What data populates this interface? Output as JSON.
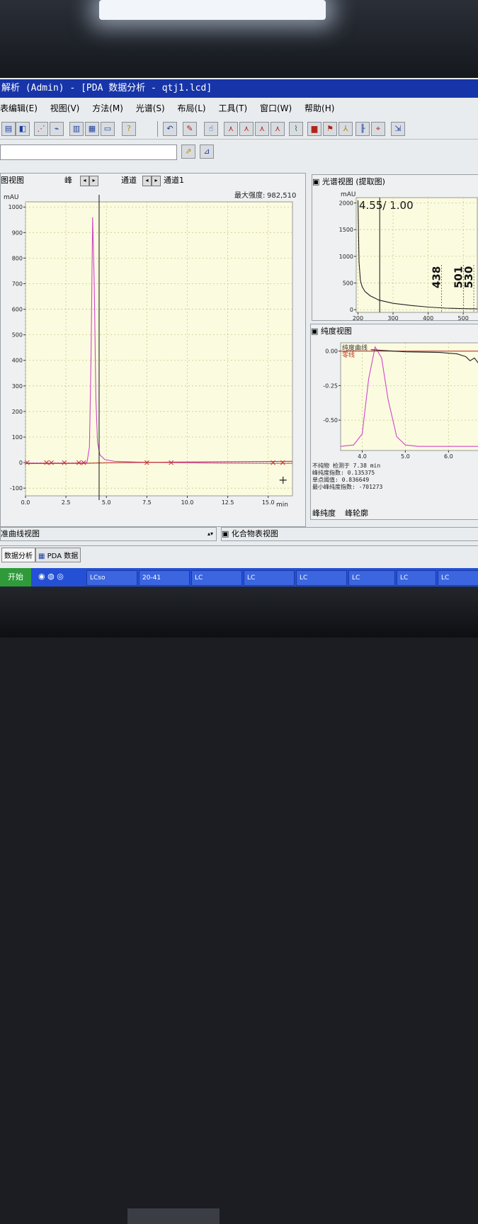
{
  "window": {
    "title": "解析 (Admin) - [PDA 数据分析 - qtj1.lcd]"
  },
  "menu": [
    "表编辑(E)",
    "视图(V)",
    "方法(M)",
    "光谱(S)",
    "布局(L)",
    "工具(T)",
    "窗口(W)",
    "帮助(H)"
  ],
  "chromatogram_panel": {
    "title": "图视图",
    "peak_label": "峰",
    "channel_label": "通道",
    "channel_value": "通道1",
    "max_intensity_label": "最大强度:",
    "max_intensity_value": "982,510",
    "unit_label": "mAU",
    "x_unit": "min"
  },
  "spectrum_panel": {
    "title": "光谱视图 (提取图)",
    "unit_label": "mAU",
    "time_label": "4.55/ 1.00",
    "peak_labels": [
      "438",
      "501",
      "530"
    ]
  },
  "purity_panel": {
    "title": "纯度视图",
    "legend_purity_curve": "纯度曲线",
    "legend_zero_line": "零线",
    "impurity_label": "不纯物 检测于",
    "impurity_value": "7.38 min",
    "peak_purity_label": "峰纯度指数:",
    "peak_purity_value": "0.135375",
    "single_point_label": "单点阈值:",
    "single_point_value": "0.836649",
    "min_peak_purity_label": "最小峰纯度指数:",
    "min_peak_purity_value": "-701273",
    "tab_purity": "峰纯度",
    "tab_outline": "峰轮廓"
  },
  "status": {
    "calibration_view": "准曲线视图",
    "compound_table_view": "化合物表视图",
    "tab_data_analysis": "数据分析",
    "tab_pda_data": "PDA 数据"
  },
  "taskbar": {
    "start": "开始",
    "items": [
      "LCso",
      "20-41",
      "LC",
      "LC",
      "LC",
      "LC",
      "LC",
      "LC"
    ]
  },
  "chart_data": [
    {
      "type": "line",
      "title": "",
      "xlabel": "min",
      "ylabel": "mAU",
      "xlim": [
        0,
        16.5
      ],
      "ylim": [
        -130,
        1020
      ],
      "xticks": [
        "0.0",
        "2.5",
        "5.0",
        "7.5",
        "10.0",
        "12.5",
        "15.0"
      ],
      "yticks": [
        "-100",
        "0",
        "100",
        "200",
        "300",
        "400",
        "500",
        "600",
        "700",
        "800",
        "900",
        "1000"
      ],
      "series": [
        {
          "color": "#d146c8",
          "x": [
            0.0,
            3.0,
            3.8,
            3.95,
            4.05,
            4.15,
            4.25,
            4.35,
            4.45,
            4.6,
            4.9,
            5.5,
            7.0,
            9.0,
            12.0,
            16.5
          ],
          "y": [
            -2,
            -2,
            0,
            60,
            400,
            960,
            700,
            250,
            80,
            30,
            12,
            5,
            2,
            0,
            -2,
            -3
          ]
        },
        {
          "color": "#c0392b",
          "x": [
            0.0,
            3.5,
            4.2,
            5.0,
            9.0,
            16.5
          ],
          "y": [
            -4,
            -3,
            -2,
            -1,
            2,
            5
          ]
        }
      ],
      "markers": [
        {
          "time": 0.1,
          "label": "peak-marker"
        },
        {
          "time": 1.3,
          "label": "peak-marker"
        },
        {
          "time": 1.6,
          "label": "peak-marker"
        },
        {
          "time": 2.4,
          "label": "peak-marker"
        },
        {
          "time": 3.3,
          "label": "peak-marker"
        },
        {
          "time": 3.6,
          "label": "peak-marker"
        },
        {
          "time": 7.5,
          "label": "peak-marker"
        },
        {
          "time": 9.0,
          "label": "peak-marker"
        },
        {
          "time": 15.3,
          "label": "peak-marker"
        },
        {
          "time": 15.9,
          "label": "peak-marker"
        }
      ],
      "cursor_time": 4.55,
      "grid": true
    },
    {
      "type": "line",
      "xlabel": "",
      "ylabel": "mAU",
      "xlim": [
        195,
        540
      ],
      "ylim": [
        -50,
        2100
      ],
      "xticks": [
        "200",
        "300",
        "400",
        "500"
      ],
      "yticks": [
        "0",
        "500",
        "1000",
        "1500",
        "2000"
      ],
      "series": [
        {
          "color": "#222222",
          "x": [
            200,
            203,
            207,
            212,
            220,
            235,
            260,
            300,
            350,
            400,
            450,
            500,
            540
          ],
          "y": [
            2050,
            900,
            550,
            430,
            340,
            260,
            180,
            120,
            80,
            50,
            30,
            20,
            15
          ]
        }
      ],
      "cursor_x": 262,
      "peak_lines": [
        438,
        501,
        530
      ],
      "grid": true
    },
    {
      "type": "line",
      "xlabel": "",
      "ylabel": "",
      "xlim": [
        3.5,
        6.7
      ],
      "ylim": [
        -0.72,
        0.06
      ],
      "xticks": [
        "4.0",
        "5.0",
        "6.0"
      ],
      "yticks": [
        "0.00",
        "-0.25",
        "-0.50"
      ],
      "series": [
        {
          "name": "纯度曲线",
          "color": "#d146c8",
          "x": [
            3.5,
            3.8,
            4.0,
            4.15,
            4.3,
            4.45,
            4.6,
            4.8,
            5.0,
            5.3,
            6.7
          ],
          "y": [
            -0.69,
            -0.68,
            -0.6,
            -0.2,
            0.03,
            -0.05,
            -0.35,
            -0.62,
            -0.68,
            -0.69,
            -0.69
          ]
        },
        {
          "name": "零线",
          "color": "#c0392b",
          "x": [
            3.5,
            6.7
          ],
          "y": [
            0.0,
            0.0
          ]
        },
        {
          "color": "#222222",
          "x": [
            4.2,
            5.0,
            5.8,
            6.2,
            6.4,
            6.5,
            6.6,
            6.7
          ],
          "y": [
            0.01,
            -0.005,
            -0.01,
            -0.02,
            -0.04,
            -0.07,
            -0.05,
            -0.09
          ]
        }
      ],
      "grid": true
    }
  ]
}
